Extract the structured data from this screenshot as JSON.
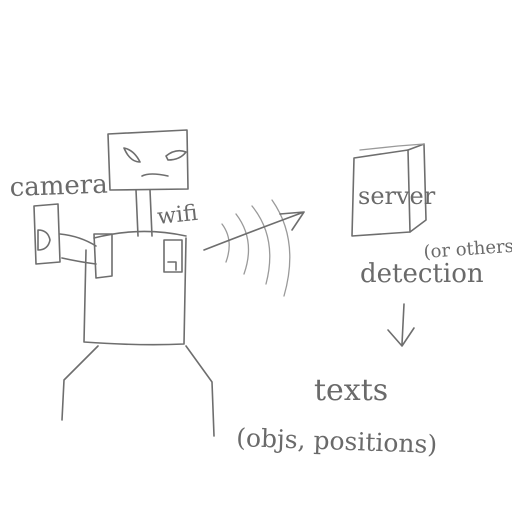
{
  "labels": {
    "camera": "camera",
    "wifi": "wifi",
    "server": "server",
    "detection": "detection",
    "or_others": "(or others)",
    "texts": "texts",
    "objs_positions": "(objs, positions)"
  },
  "colors": {
    "ink": "#6e6e6e",
    "background": "#ffffff"
  }
}
